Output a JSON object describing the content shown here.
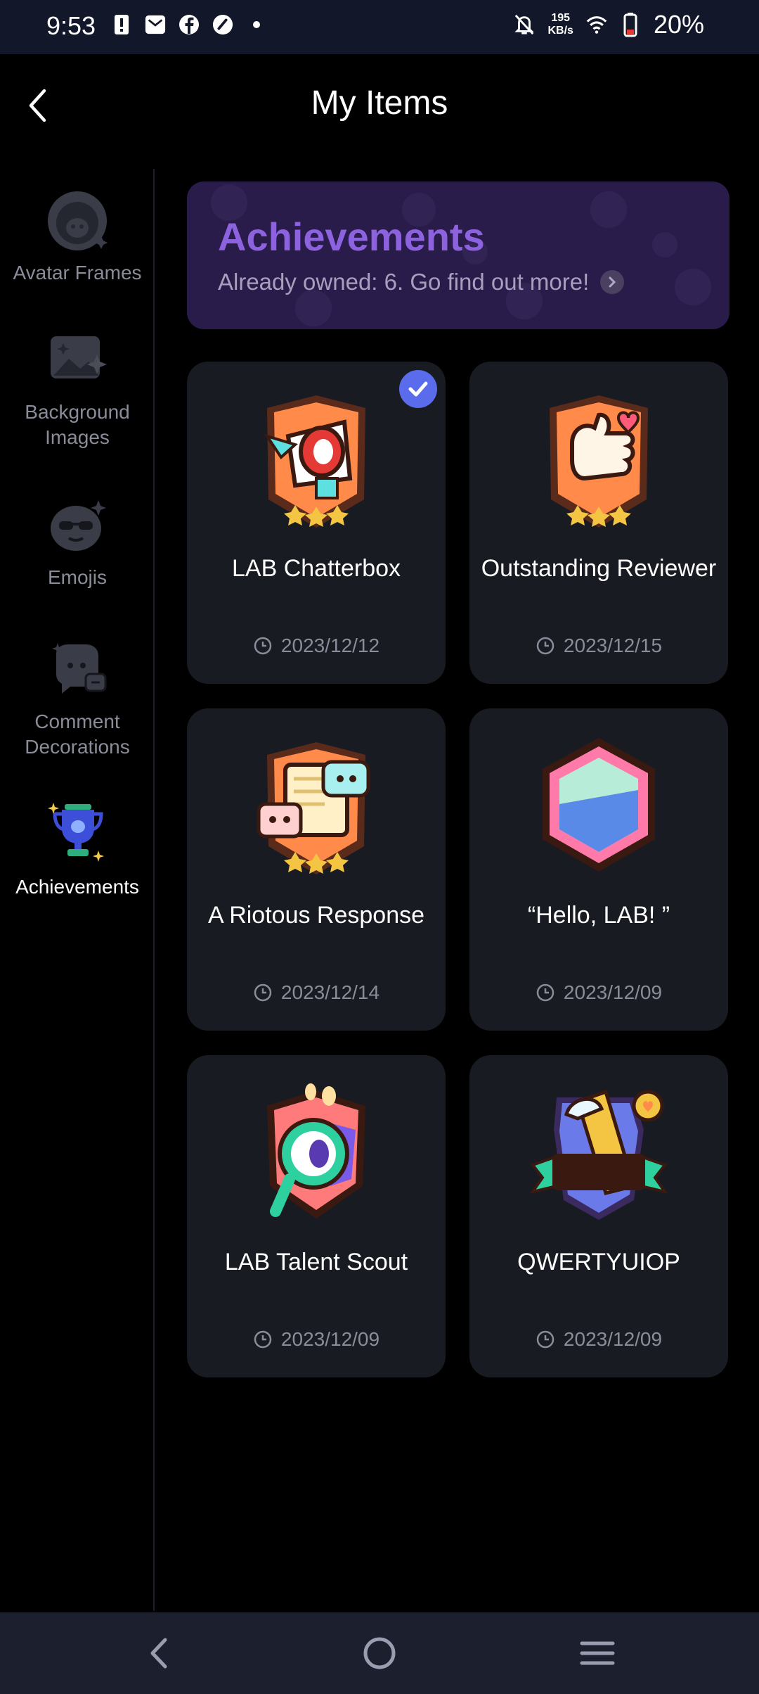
{
  "status_bar": {
    "time": "9:53",
    "net_speed_value": "195",
    "net_speed_unit": "KB/s",
    "battery": "20%"
  },
  "header": {
    "title": "My Items"
  },
  "sidebar": {
    "items": [
      {
        "label": "Avatar Frames",
        "icon": "avatar-frame-icon"
      },
      {
        "label": "Background Images",
        "icon": "background-image-icon"
      },
      {
        "label": "Emojis",
        "icon": "emoji-icon"
      },
      {
        "label": "Comment Decorations",
        "icon": "comment-decoration-icon"
      },
      {
        "label": "Achievements",
        "icon": "trophy-icon",
        "active": true
      }
    ]
  },
  "banner": {
    "title": "Achievements",
    "subtitle": "Already owned: 6. Go find out more!"
  },
  "achievements": [
    {
      "name": "LAB Chatterbox",
      "date": "2023/12/12",
      "selected": true,
      "icon": "megaphone-badge-icon"
    },
    {
      "name": "Outstanding Reviewer",
      "date": "2023/12/15",
      "selected": false,
      "icon": "thumbs-up-badge-icon"
    },
    {
      "name": "A Riotous Response",
      "date": "2023/12/14",
      "selected": false,
      "icon": "scroll-chat-badge-icon"
    },
    {
      "name": "“Hello, LAB! ”",
      "date": "2023/12/09",
      "selected": false,
      "icon": "hello-lab-badge-icon"
    },
    {
      "name": "LAB Talent Scout",
      "date": "2023/12/09",
      "selected": false,
      "icon": "magnifier-badge-icon"
    },
    {
      "name": "QWERTYUIOP",
      "date": "2023/12/09",
      "selected": false,
      "icon": "first-place-badge-icon"
    }
  ],
  "colors": {
    "accent_purple": "#8d62df",
    "check_blue": "#5a6bec",
    "card_bg": "#191b22",
    "status_bar_bg": "#13172a"
  }
}
